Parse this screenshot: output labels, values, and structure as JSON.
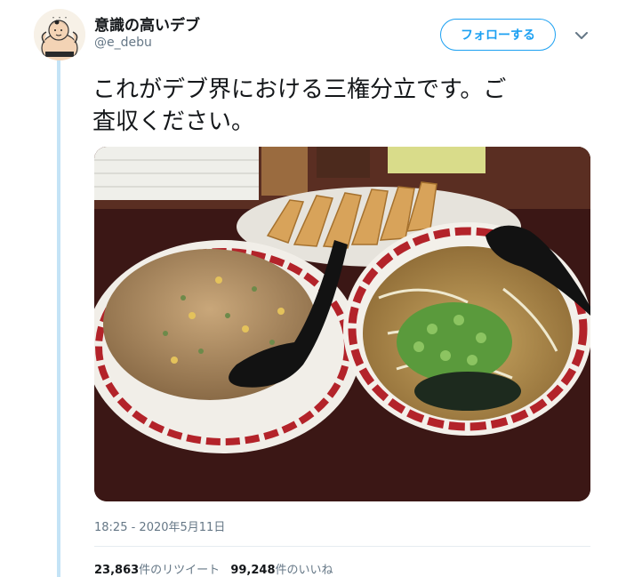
{
  "author": {
    "display_name": "意識の高いデブ",
    "username": "@e_debu",
    "avatar_icon": "sumo-wrestler-avatar-icon"
  },
  "follow_button": {
    "label": "フォローする"
  },
  "menu_icon": "chevron-down-icon",
  "tweet": {
    "text_line1": "これがデブ界における三権分立です。ご",
    "text_line2": "査収ください。",
    "photo_subject": "food-photo"
  },
  "meta": {
    "timestamp": "18:25 - 2020年5月11日"
  },
  "stats": {
    "retweet_count": "23,863",
    "retweet_label": "件のリツイート",
    "like_count": "99,248",
    "like_label": "件のいいね"
  },
  "colors": {
    "accent": "#1da1f2",
    "secondary_text": "#657786",
    "thread_line": "#c4e3f6"
  }
}
